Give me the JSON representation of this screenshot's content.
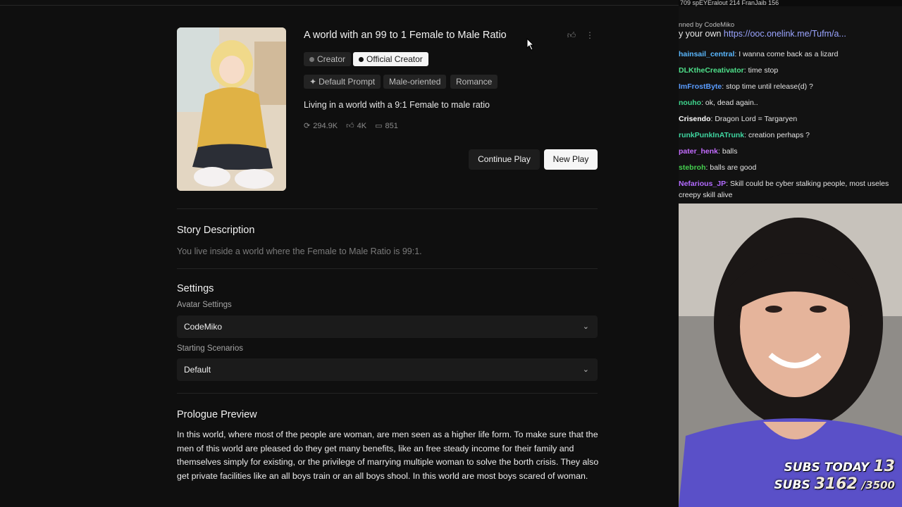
{
  "story": {
    "title": "A world with an 99 to 1 Female to Male Ratio",
    "creator_label": "Creator",
    "official_label": "Official Creator",
    "tags": [
      "Default Prompt",
      "Male-oriented",
      "Romance"
    ],
    "tagline": "Living in a world with a 9:1 Female to male ratio",
    "stats": {
      "plays": "294.9K",
      "likes": "4K",
      "comments": "851"
    },
    "continue_label": "Continue Play",
    "new_label": "New Play"
  },
  "description": {
    "heading": "Story Description",
    "text": "You live inside a world where the Female to Male Ratio is 99:1."
  },
  "settings": {
    "heading": "Settings",
    "avatar_label": "Avatar Settings",
    "avatar_value": "CodeMiko",
    "scenario_label": "Starting Scenarios",
    "scenario_value": "Default"
  },
  "prologue": {
    "heading": "Prologue Preview",
    "text": "In this world, where most of the people are woman, are men seen as a higher life form. To make sure that the men of this world are pleased do they get many benefits, like an free steady income for their family and themselves simply for existing, or the privilege of marrying multiple woman to solve the borth crisis. They also get private facilities like an all boys train or an all boys shool. In this world are most boys scared of woman."
  },
  "stream": {
    "topbar": "709   spEYEralout 214   FranJaib 156",
    "pinned_by": "nned by  CodeMiko",
    "pinned_prefix": "y your own ",
    "pinned_link": "https://ooc.onelink.me/Tufm/a...",
    "chat": [
      {
        "user": "hainsail_central",
        "color": "#5ab8ff",
        "text": ": I wanna come back as a lizard"
      },
      {
        "user": "DLKtheCreativator",
        "color": "#4ee08a",
        "text": ": time stop"
      },
      {
        "user": "ImFrostByte",
        "color": "#5a9cff",
        "text": ": stop time until release(d) ?"
      },
      {
        "user": "nouho",
        "color": "#3fd68e",
        "text": ": ok, dead again.."
      },
      {
        "user": "Crisendo",
        "color": "#ffffff",
        "text": ": Dragon Lord = Targaryen"
      },
      {
        "user": "runkPunkInATrunk",
        "color": "#3fd6a0",
        "text": ": creation perhaps ?"
      },
      {
        "user": "pater_henk",
        "color": "#c46cff",
        "text": ": balls"
      },
      {
        "user": "stebroh",
        "color": "#45d04f",
        "text": ": balls are good"
      },
      {
        "user": "Nefarious_JP",
        "color": "#b36bff",
        "text": ": Skill could be cyber stalking people, most useles"
      }
    ],
    "chat_continuation": "creepy skill alive",
    "subs_today_label": "SUBS TODAY",
    "subs_today": "13",
    "subs_label": "SUBS",
    "subs_count": "3162",
    "subs_goal": "/3500"
  }
}
